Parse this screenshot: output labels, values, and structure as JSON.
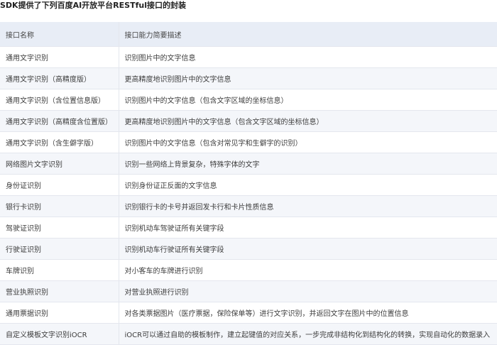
{
  "caption": "SDK提供了下列百度AI开放平台RESTful接口的封装",
  "table": {
    "headers": [
      "接口名称",
      "接口能力简要描述"
    ],
    "rows": [
      [
        "通用文字识别",
        "识别图片中的文字信息"
      ],
      [
        "通用文字识别（高精度版）",
        "更高精度地识别图片中的文字信息"
      ],
      [
        "通用文字识别（含位置信息版）",
        "识别图片中的文字信息（包含文字区域的坐标信息）"
      ],
      [
        "通用文字识别（高精度含位置版）",
        "更高精度地识别图片中的文字信息（包含文字区域的坐标信息）"
      ],
      [
        "通用文字识别（含生僻字版）",
        "识别图片中的文字信息（包含对常见字和生僻字的识别）"
      ],
      [
        "网络图片文字识别",
        "识别一些网络上背景复杂，特殊字体的文字"
      ],
      [
        "身份证识别",
        "识别身份证正反面的文字信息"
      ],
      [
        "银行卡识别",
        "识别银行卡的卡号并返回发卡行和卡片性质信息"
      ],
      [
        "驾驶证识别",
        "识别机动车驾驶证所有关键字段"
      ],
      [
        "行驶证识别",
        "识别机动车行驶证所有关键字段"
      ],
      [
        "车牌识别",
        "对小客车的车牌进行识别"
      ],
      [
        "营业执照识别",
        "对营业执照进行识别"
      ],
      [
        "通用票据识别",
        "对各类票据图片（医疗票据，保险保单等）进行文字识别，并返回文字在图片中的位置信息"
      ],
      [
        "自定义模板文字识别iOCR",
        "iOCR可以通过自助的模板制作，建立起键值的对应关系，一步完成非结构化到结构化的转换，实现自动化的数据录入"
      ]
    ]
  }
}
